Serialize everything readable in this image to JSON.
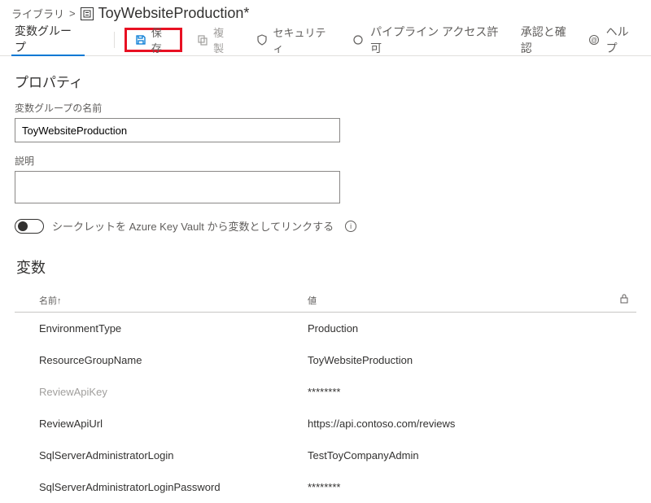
{
  "breadcrumb": {
    "library": "ライブラリ",
    "sep": ">",
    "title": "ToyWebsiteProduction*"
  },
  "toolbar": {
    "tab_active": "変数グループ",
    "save_label": "保存",
    "clone_label": "複製",
    "security_label": "セキュリティ",
    "pipeline_perms": "パイプライン アクセス許可",
    "approvals": "承認と確認",
    "help": "ヘルプ"
  },
  "properties": {
    "heading": "プロパティ",
    "name_label": "変数グループの名前",
    "name_value": "ToyWebsiteProduction",
    "desc_label": "説明",
    "desc_value": "",
    "kv_toggle_label": "シークレットを Azure Key Vault から変数としてリンクする"
  },
  "variables": {
    "heading": "変数",
    "col_name": "名前↑",
    "col_value": "値",
    "rows": [
      {
        "name": "EnvironmentType",
        "value": "Production",
        "secret": false
      },
      {
        "name": "ResourceGroupName",
        "value": "ToyWebsiteProduction",
        "secret": false
      },
      {
        "name": "ReviewApiKey",
        "value": "********",
        "secret": true
      },
      {
        "name": "ReviewApiUrl",
        "value": "https://api.contoso.com/reviews",
        "secret": false
      },
      {
        "name": "SqlServerAdministratorLogin",
        "value": "TestToyCompanyAdmin",
        "secret": false
      },
      {
        "name": "SqlServerAdministratorLoginPassword",
        "value": "********",
        "secret": false
      }
    ]
  }
}
